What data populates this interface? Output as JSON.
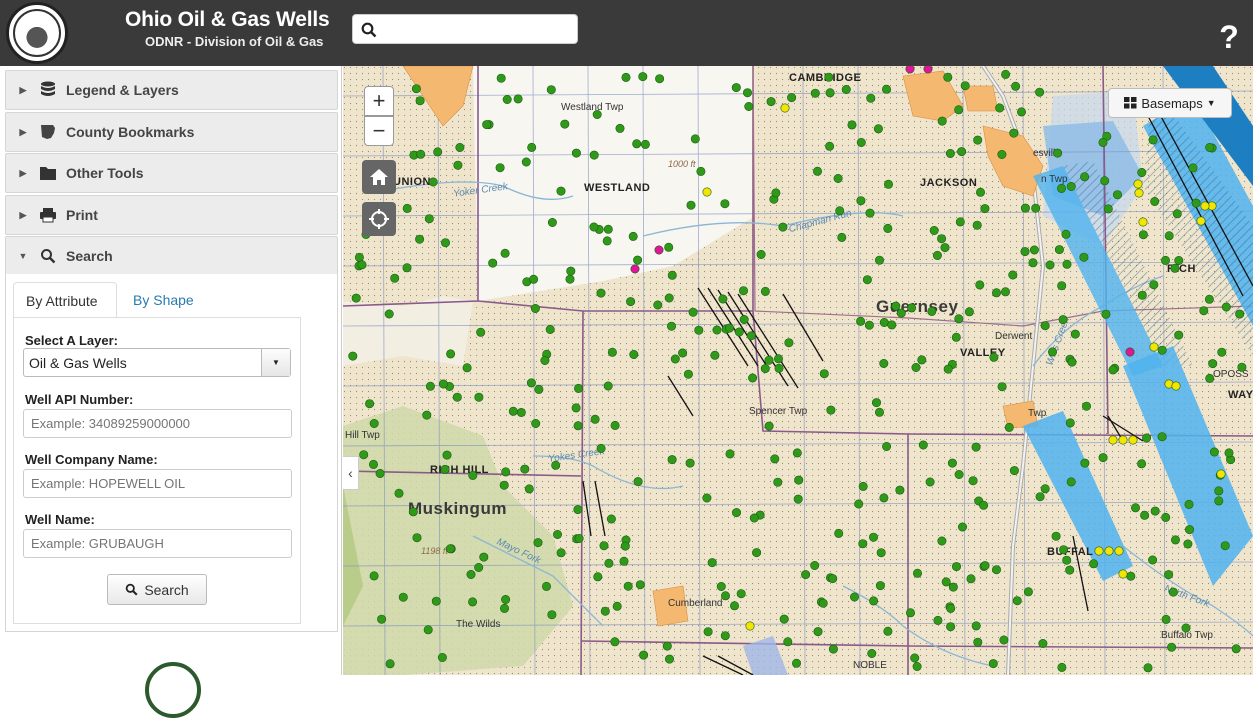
{
  "header": {
    "title": "Ohio Oil & Gas Wells",
    "subtitle": "ODNR - Division of Oil & Gas",
    "search_placeholder": "",
    "help_glyph": "?"
  },
  "sidebar": {
    "panels": [
      {
        "label": "Legend & Layers",
        "icon": "database-icon",
        "expanded": false
      },
      {
        "label": "County Bookmarks",
        "icon": "ohio-shape-icon",
        "expanded": false
      },
      {
        "label": "Other Tools",
        "icon": "folder-icon",
        "expanded": false
      },
      {
        "label": "Print",
        "icon": "printer-icon",
        "expanded": false
      },
      {
        "label": "Search",
        "icon": "magnifier-icon",
        "expanded": true
      }
    ],
    "search": {
      "tabs": [
        "By Attribute",
        "By Shape"
      ],
      "active_tab": "By Attribute",
      "layer_label": "Select A Layer:",
      "layer_value": "Oil & Gas Wells",
      "api_label": "Well API Number:",
      "api_placeholder": "Example: 34089259000000",
      "company_label": "Well Company Name:",
      "company_placeholder": "Example: HOPEWELL OIL",
      "name_label": "Well Name:",
      "name_placeholder": "Example: GRUBAUGH",
      "button_label": "Search"
    }
  },
  "map": {
    "controls": {
      "zoom_in": "+",
      "zoom_out": "−",
      "basemaps": "Basemaps"
    },
    "labels": {
      "cambridge": "CAMBRIDGE",
      "westland_twp": "Westland Twp",
      "union": "UNION",
      "westland": "WESTLAND",
      "jackson": "JACKSON",
      "guernsey": "Guernsey",
      "valley": "VALLEY",
      "derwent": "Derwent",
      "spencer_twp": "Spencer Twp",
      "hill_twp": "Hill Twp",
      "rich_hill": "RICH HILL",
      "muskingum": "Muskingum",
      "cumberland": "Cumberland",
      "buffalo_twp": "Buffalo Twp",
      "buffalo": "BUFFAL",
      "noble": "NOBLE",
      "rich": "RICH",
      "wayne": "WAYN",
      "the_wilds": "The Wilds",
      "oppossum": "OPOSS",
      "yoker_creek": "Yoker Creek",
      "yokes_creek": "Yokes Creek",
      "chapman_run": "Chapman Run",
      "wills_creek": "Wills Creek",
      "mayo_fork": "Mayo Fork",
      "north_fork": "North Fork",
      "elev_1198": "1198 ft",
      "elev_1000": "1000 ft",
      "town_twp": "Twp",
      "esville": "esville",
      "n_twp": "n Twp"
    },
    "colors": {
      "well_producing": "#2f9a1a",
      "well_permitted": "#f2e600",
      "well_other": "#e0169a",
      "horizontal_unit": "#4fb3ef",
      "urban": "#f5b871"
    }
  }
}
